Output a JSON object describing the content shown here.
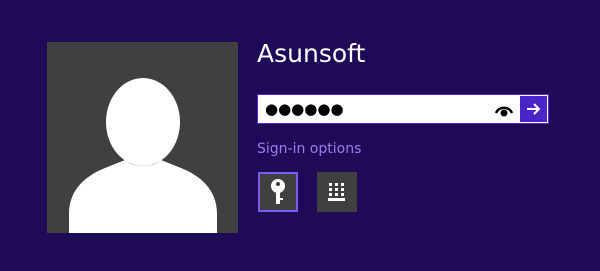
{
  "user": {
    "name": "Asunsoft",
    "avatar_icon": "default-user-silhouette"
  },
  "password_field": {
    "masked_value": "●●●●●●",
    "reveal_icon": "eye-icon",
    "submit_icon": "arrow-right-icon"
  },
  "signin_options": {
    "label": "Sign-in options",
    "options": [
      {
        "name": "password",
        "icon": "key-icon",
        "selected": true
      },
      {
        "name": "pin",
        "icon": "keypad-icon",
        "selected": false
      }
    ]
  },
  "colors": {
    "background": "#1f0a57",
    "accent": "#4b25c8",
    "link": "#9b7cf0",
    "tile": "#404040"
  }
}
